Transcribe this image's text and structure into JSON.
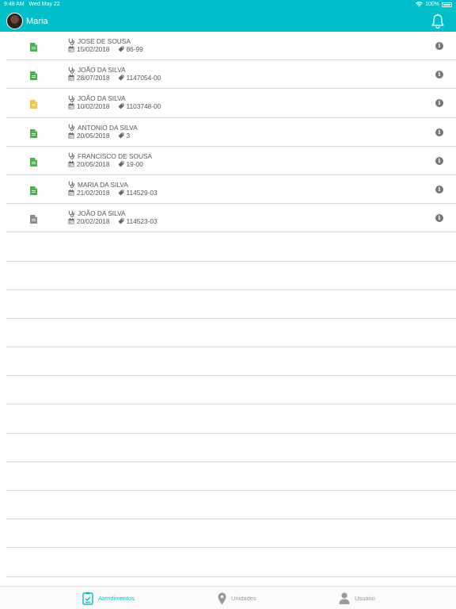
{
  "status_bar": {
    "time": "9:48 AM",
    "date": "Wed May 22",
    "battery": "100%"
  },
  "header": {
    "user_name": "Maria"
  },
  "colors": {
    "accent": "#00bfc8",
    "doc_green": "#4caf50",
    "doc_yellow": "#f5c542",
    "doc_gray": "#8a8a8a"
  },
  "appointments": [
    {
      "doctor": "JOSE DE SOUSA",
      "date": "15/02/2018",
      "code": "86-99",
      "status_color": "green"
    },
    {
      "doctor": "JOÃO DA SILVA",
      "date": "28/07/2018",
      "code": "1147054-00",
      "status_color": "green"
    },
    {
      "doctor": "JOÃO DA SILVA",
      "date": "10/02/2018",
      "code": "1103748-00",
      "status_color": "yellow"
    },
    {
      "doctor": "ANTONIO DA SILVA",
      "date": "20/05/2018",
      "code": "3",
      "status_color": "green"
    },
    {
      "doctor": "FRANCISCO DE SOUSA",
      "date": "20/05/2018",
      "code": "19-00",
      "status_color": "green"
    },
    {
      "doctor": "MARIA DA SILVA",
      "date": "21/02/2018",
      "code": "114529-03",
      "status_color": "green"
    },
    {
      "doctor": "JOÃO DA SILVA",
      "date": "20/02/2018",
      "code": "114523-03",
      "status_color": "gray"
    }
  ],
  "tabs": [
    {
      "label": "Atendimentos",
      "icon": "clipboard-icon",
      "active": true
    },
    {
      "label": "Unidades",
      "icon": "map-pin-icon",
      "active": false
    },
    {
      "label": "Usuário",
      "icon": "user-icon",
      "active": false
    }
  ]
}
